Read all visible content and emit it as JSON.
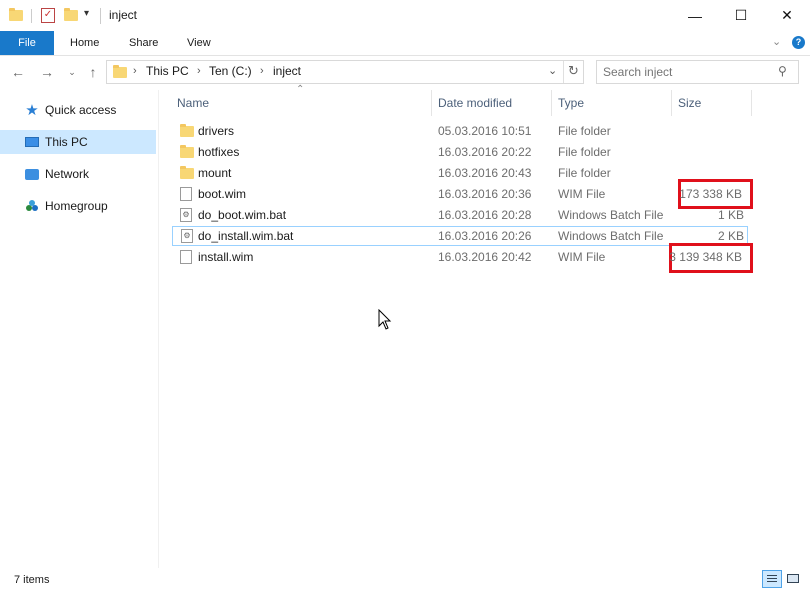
{
  "window": {
    "title": "inject",
    "minimize": "—",
    "maximize": "☐",
    "close": "✕"
  },
  "ribbon": {
    "tabs": [
      {
        "label": "File"
      },
      {
        "label": "Home"
      },
      {
        "label": "Share"
      },
      {
        "label": "View"
      }
    ]
  },
  "address": {
    "segments": [
      "This PC",
      "Ten (C:)",
      "inject"
    ],
    "search_placeholder": "Search inject"
  },
  "nav": {
    "items": [
      {
        "label": "Quick access"
      },
      {
        "label": "This PC"
      },
      {
        "label": "Network"
      },
      {
        "label": "Homegroup"
      }
    ]
  },
  "columns": {
    "name": "Name",
    "date": "Date modified",
    "type": "Type",
    "size": "Size"
  },
  "files": [
    {
      "name": "drivers",
      "date": "05.03.2016 10:51",
      "type": "File folder",
      "size": ""
    },
    {
      "name": "hotfixes",
      "date": "16.03.2016 20:22",
      "type": "File folder",
      "size": ""
    },
    {
      "name": "mount",
      "date": "16.03.2016 20:43",
      "type": "File folder",
      "size": ""
    },
    {
      "name": "boot.wim",
      "date": "16.03.2016 20:36",
      "type": "WIM File",
      "size": "173 338 KB"
    },
    {
      "name": "do_boot.wim.bat",
      "date": "16.03.2016 20:28",
      "type": "Windows Batch File",
      "size": "1 KB"
    },
    {
      "name": "do_install.wim.bat",
      "date": "16.03.2016 20:26",
      "type": "Windows Batch File",
      "size": "2 KB"
    },
    {
      "name": "install.wim",
      "date": "16.03.2016 20:42",
      "type": "WIM File",
      "size": "3 139 348 KB"
    }
  ],
  "status": {
    "item_count": "7 items"
  },
  "colors": {
    "accent": "#1979ca",
    "highlight": "#e0101b",
    "folder": "#f8d775",
    "selected_nav": "#cce8ff"
  }
}
